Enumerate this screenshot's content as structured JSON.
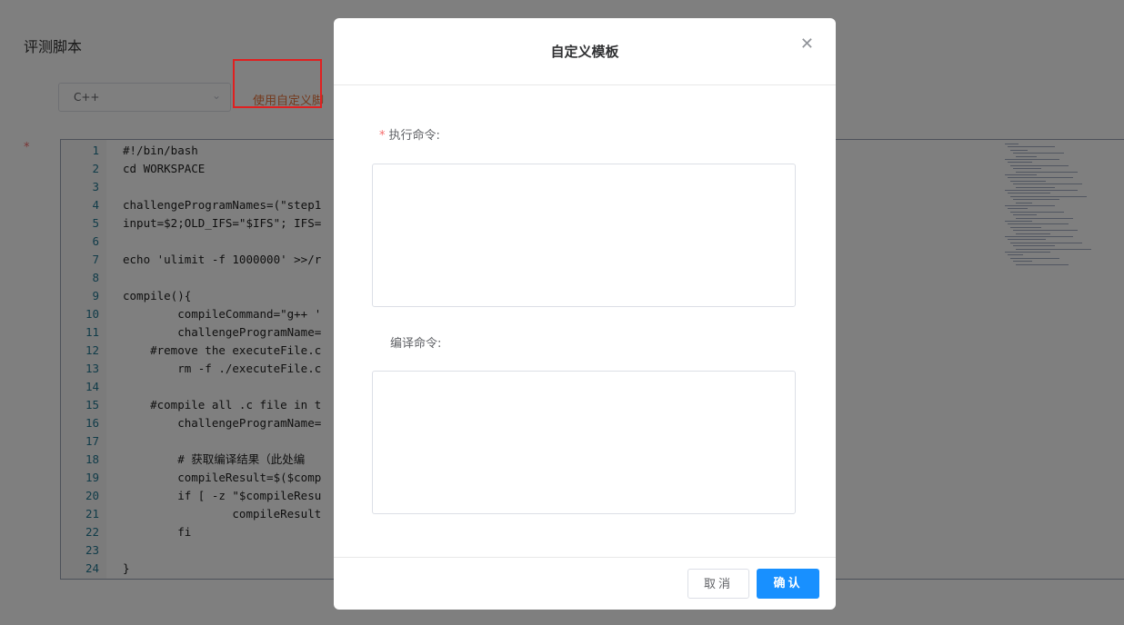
{
  "page": {
    "title": "评测脚本"
  },
  "language_select": {
    "value": "C++",
    "chevron": "chevron-down-icon"
  },
  "custom_link": {
    "label": "使用自定义脚"
  },
  "required_mark": "*",
  "editor": {
    "lines": [
      {
        "n": "1",
        "text": "#!/bin/bash"
      },
      {
        "n": "2",
        "text": "cd WORKSPACE"
      },
      {
        "n": "3",
        "text": ""
      },
      {
        "n": "4",
        "text": "challengeProgramNames=(\"step1"
      },
      {
        "n": "5",
        "text": "input=$2;OLD_IFS=\"$IFS\"; IFS="
      },
      {
        "n": "6",
        "text": ""
      },
      {
        "n": "7",
        "text": "echo 'ulimit -f 1000000' >>/r"
      },
      {
        "n": "8",
        "text": ""
      },
      {
        "n": "9",
        "text": "compile(){"
      },
      {
        "n": "10",
        "text": "        compileCommand=\"g++ '"
      },
      {
        "n": "11",
        "text": "        challengeProgramName="
      },
      {
        "n": "12",
        "text": "    #remove the executeFile.c"
      },
      {
        "n": "13",
        "text": "        rm -f ./executeFile.c"
      },
      {
        "n": "14",
        "text": ""
      },
      {
        "n": "15",
        "text": "    #compile all .c file in t"
      },
      {
        "n": "16",
        "text": "        challengeProgramName="
      },
      {
        "n": "17",
        "text": ""
      },
      {
        "n": "18",
        "text": "        # 获取编译结果（此处编"
      },
      {
        "n": "19",
        "text": "        compileResult=$($comp"
      },
      {
        "n": "20",
        "text": "        if [ -z \"$compileResu"
      },
      {
        "n": "21",
        "text": "                compileResult"
      },
      {
        "n": "22",
        "text": "        fi"
      },
      {
        "n": "23",
        "text": ""
      },
      {
        "n": "24",
        "text": "}"
      }
    ]
  },
  "modal": {
    "title": "自定义模板",
    "close_icon": "close-icon",
    "exec_label_star": "*",
    "exec_label": "执行命令:",
    "exec_value": "",
    "compile_label": "编译命令:",
    "compile_value": "",
    "cancel_label": "取消",
    "confirm_label": "确认"
  },
  "colors": {
    "accent": "#1890ff",
    "annotation": "#e02020",
    "link": "#e8733a"
  }
}
